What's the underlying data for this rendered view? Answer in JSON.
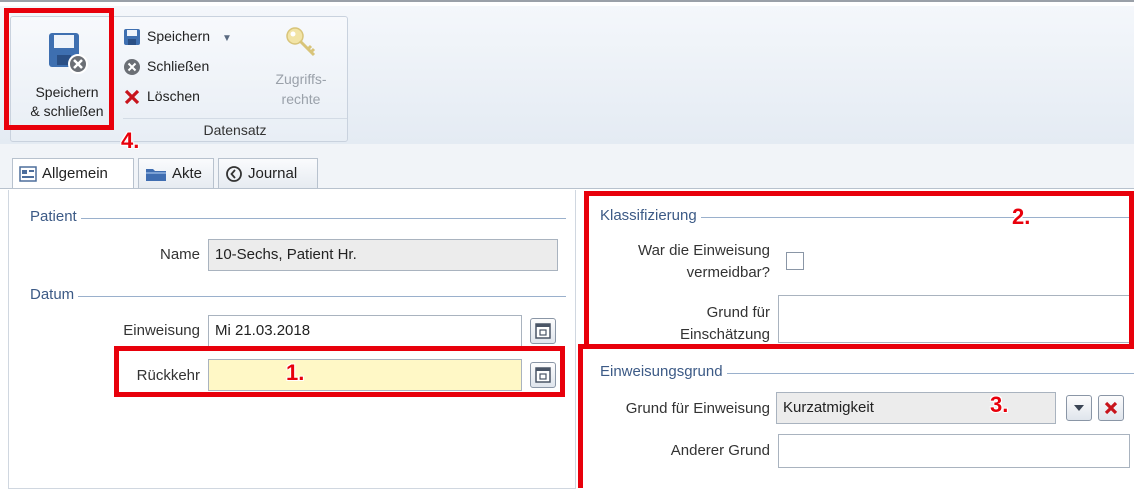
{
  "ribbon": {
    "big_button": {
      "line1": "Speichern",
      "line2": "& schließen",
      "icon": "save-close-icon"
    },
    "save_dropdown": {
      "label": "Speichern",
      "icon": "save-icon"
    },
    "close": {
      "label": "Schließen",
      "icon": "close-circle-icon"
    },
    "delete": {
      "label": "Löschen",
      "icon": "delete-x-icon"
    },
    "access_rights": {
      "line1": "Zugriffs-",
      "line2": "rechte",
      "icon": "key-icon"
    },
    "group_label": "Datensatz"
  },
  "tabs": [
    {
      "label": "Allgemein",
      "icon": "form-icon",
      "active": true
    },
    {
      "label": "Akte",
      "icon": "folder-icon",
      "active": false
    },
    {
      "label": "Journal",
      "icon": "history-icon",
      "active": false
    }
  ],
  "patient": {
    "section": "Patient",
    "name_label": "Name",
    "name_value": "10-Sechs, Patient Hr."
  },
  "datum": {
    "section": "Datum",
    "einweisung_label": "Einweisung",
    "einweisung_value": "Mi 21.03.2018",
    "rueckkehr_label": "Rückkehr",
    "rueckkehr_value": ""
  },
  "klassifizierung": {
    "section": "Klassifizierung",
    "avoidable_label_line1": "War die Einweisung",
    "avoidable_label_line2": "vermeidbar?",
    "reason_label_line1": "Grund für",
    "reason_label_line2": "Einschätzung",
    "reason_value": ""
  },
  "einweisungsgrund": {
    "section": "Einweisungsgrund",
    "grund_label": "Grund für Einweisung",
    "grund_value": "Kurzatmigkeit",
    "anderer_label": "Anderer Grund",
    "anderer_value": ""
  },
  "markers": {
    "m1": "1.",
    "m2": "2.",
    "m3": "3.",
    "m4": "4."
  },
  "colors": {
    "highlight": "#e8000b",
    "section_title": "#3c5a86",
    "yellow_field": "#fff8c6"
  }
}
